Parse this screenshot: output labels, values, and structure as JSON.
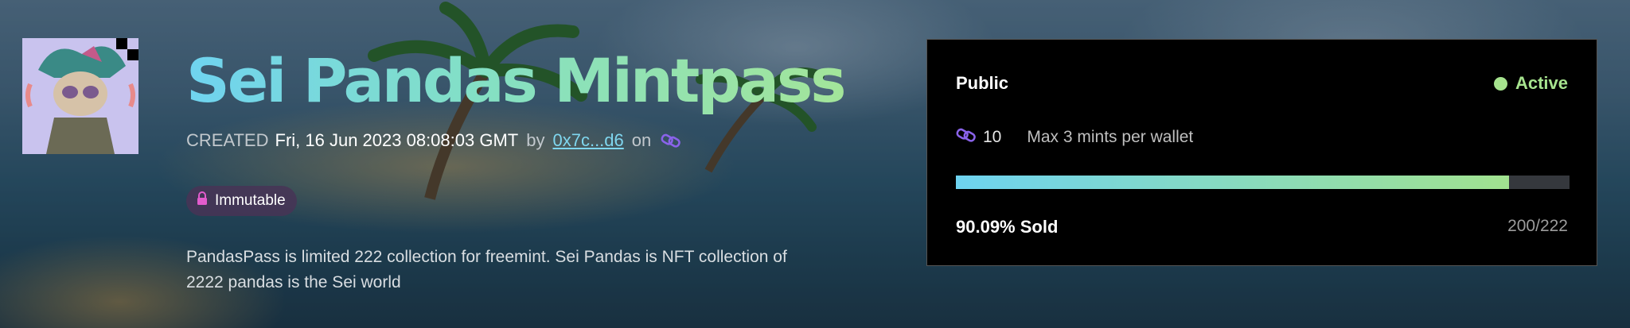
{
  "collection": {
    "title": "Sei Pandas Mintpass",
    "created_label": "CREATED",
    "created_date": "Fri, 16 Jun 2023 08:08:03 GMT",
    "by_label": "by",
    "creator_address": "0x7c...d6",
    "on_label": "on",
    "chain_icon": "chain-link-icon",
    "badge_label": "Immutable",
    "badge_icon": "lock-icon",
    "description": "PandasPass is limited 222 collection for freemint. Sei Pandas is NFT collection of 2222 pandas is the Sei world"
  },
  "mint_panel": {
    "phase": "Public",
    "status": "Active",
    "status_color": "#a6e38e",
    "price": "10",
    "limit_text": "Max 3 mints per wallet",
    "progress_fraction": 0.9009,
    "sold_text": "90.09% Sold",
    "count_text": "200/222"
  },
  "colors": {
    "title_gradient_start": "#6fd3f0",
    "title_gradient_end": "#a3e59a",
    "address_link": "#7fd6ef",
    "panel_bg": "#000000"
  }
}
